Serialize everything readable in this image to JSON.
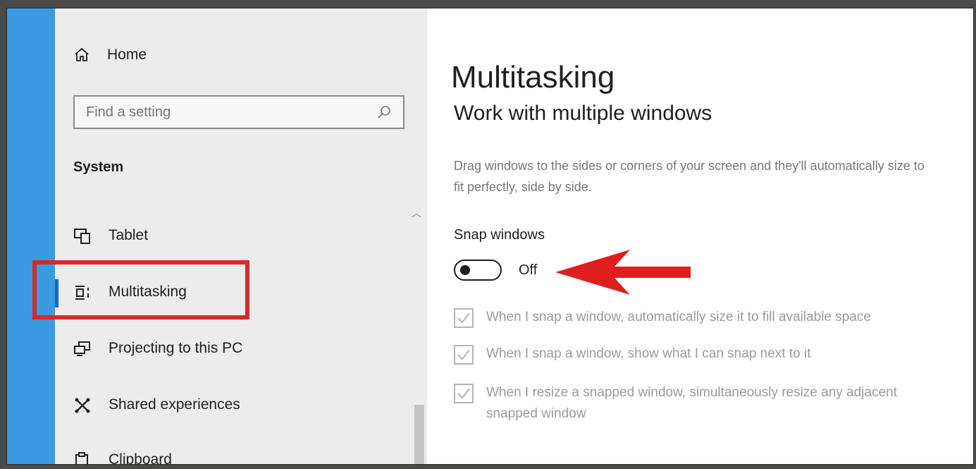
{
  "sidebar": {
    "home_label": "Home",
    "search_placeholder": "Find a setting",
    "section_title": "System",
    "items": [
      {
        "label": "Tablet",
        "icon": "tablet-icon"
      },
      {
        "label": "Multitasking",
        "icon": "multitasking-icon",
        "selected": true
      },
      {
        "label": "Projecting to this PC",
        "icon": "projecting-icon"
      },
      {
        "label": "Shared experiences",
        "icon": "shared-experiences-icon"
      },
      {
        "label": "Clipboard",
        "icon": "clipboard-icon"
      }
    ]
  },
  "main": {
    "title": "Multitasking",
    "subtitle": "Work with multiple windows",
    "description": "Drag windows to the sides or corners of your screen and they'll automatically size to fit perfectly, side by side.",
    "snap_label": "Snap windows",
    "snap_state": "Off",
    "options": [
      {
        "label": "When I snap a window, automatically size it to fill available space",
        "checked": true,
        "disabled": true
      },
      {
        "label": "When I snap a window, show what I can snap next to it",
        "checked": true,
        "disabled": true
      },
      {
        "label": "When I resize a snapped window, simultaneously resize any adjacent snapped window",
        "checked": true,
        "disabled": true
      }
    ]
  },
  "colors": {
    "accent_strip": "#3c9ae3",
    "selection_indicator": "#0a6cd0",
    "annotation_red": "#d42a2a",
    "sidebar_bg": "#ececec"
  }
}
